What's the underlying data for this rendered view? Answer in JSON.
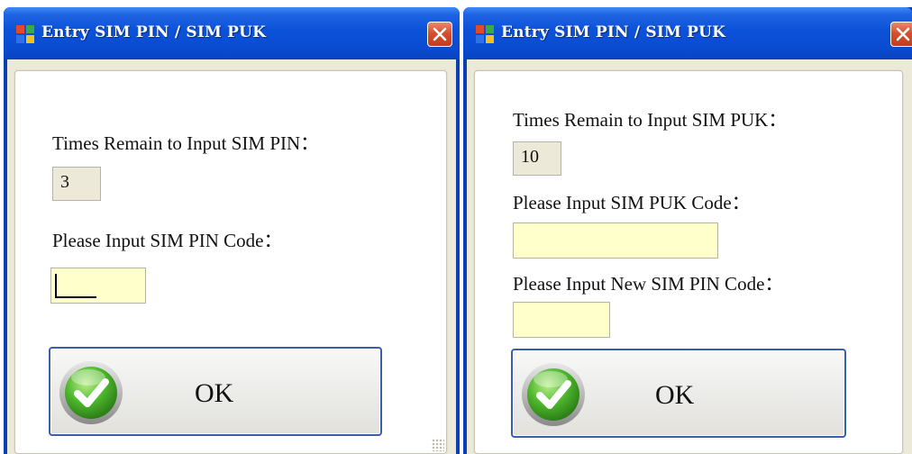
{
  "pin_dialog": {
    "title": "Entry SIM PIN / SIM PUK",
    "times_remain_label": "Times Remain to Input SIM PIN：",
    "times_remain_value": "3",
    "pin_code_label": "Please Input SIM PIN Code：",
    "pin_code_value": "",
    "ok_label": "OK"
  },
  "puk_dialog": {
    "title": "Entry SIM PIN / SIM PUK",
    "times_remain_label": "Times Remain to Input SIM PUK：",
    "times_remain_value": "10",
    "puk_code_label": "Please Input SIM PUK Code：",
    "puk_code_value": "",
    "new_pin_label": "Please Input New SIM PIN Code：",
    "new_pin_value": "",
    "ok_label": "OK"
  },
  "icons": {
    "app": "app-window-icon",
    "close": "close-x-icon",
    "ok": "green-checkmark-icon"
  },
  "colors": {
    "titlebar": "#0b52d9",
    "close_button": "#d6502e",
    "input_background": "#ffffcc",
    "readonly_background": "#ece9d8",
    "ok_border": "#3a5fa8"
  }
}
